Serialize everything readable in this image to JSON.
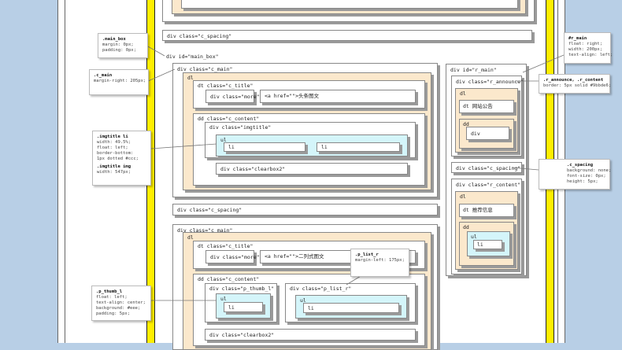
{
  "colors": {
    "background": "#b8cfe6",
    "page": "#ffffff",
    "stripe": "#ffee00",
    "cream": "#fbe8cc",
    "cyan": "#d4f5fa"
  },
  "top": {
    "spacing": "div class=\"c_spacing\"",
    "main_box": "div id=\"main_box\""
  },
  "c_main_1": {
    "label": "div class=\"c_main\"",
    "dl": "dl",
    "dt": "dt class=\"c_title\"",
    "more": "div class=\"more\"",
    "link": "<a href=\"\">头条图文",
    "dd": "dd class=\"c_content\"",
    "imgtitle": "div class=\"imgtitle\"",
    "ul": "ul",
    "li1": "li",
    "li2": "li",
    "clearbox": "div class=\"clearbox2\""
  },
  "middle_spacing": "div class=\"c_spacing\"",
  "c_main_2": {
    "label": "div class=\"c_main\"",
    "dl": "dl",
    "dt": "dt class=\"c_title\"",
    "more": "div class=\"more\"",
    "link": "<a href=\"\">二列式图文",
    "dd": "dd class=\"c_content\"",
    "thumb": "div class=\"p_thumb_l\"",
    "list": "div class=\"p_list_r\"",
    "ul1": "ul",
    "li1": "li",
    "ul2": "ul",
    "li2": "li",
    "clearbox": "div class=\"clearbox2\""
  },
  "right": {
    "r_main": "div id=\"r_main\"",
    "announce": "div class=\"r_announce\"",
    "dl1": "dl",
    "dt1": "dt  网站公告",
    "dd1": "dd",
    "div": "div",
    "spacing": "div class=\"c_spacing\"",
    "content": "div class=\"r_content\"",
    "dl2": "dl",
    "dt2": "dt  推荐信息",
    "dd2": "dd",
    "ul": "ul",
    "li": "li"
  },
  "notes": {
    "main_box": {
      "sel": ".main_box",
      "lines": [
        "margin: 0px;",
        "padding: 0px;"
      ]
    },
    "c_main": {
      "sel": ".c_main",
      "lines": [
        "margin-right: 205px;"
      ]
    },
    "imgtitle": {
      "sel": ".imgtitle li",
      "lines": [
        "width: 49.5%;",
        "float: left;",
        "border-bottom:",
        "  1px dotted #ccc;"
      ],
      "sel2": ".imgtitle img",
      "lines2": [
        "width: 547px;"
      ]
    },
    "p_thumb": {
      "sel": ".p_thumb_l",
      "lines": [
        "float: left;",
        "text-align: center;",
        "background: #eee;",
        "padding: 5px;"
      ]
    },
    "p_list": {
      "sel": ".p_list_r",
      "lines": [
        "margin-left: 175px;"
      ]
    },
    "r_main": {
      "sel": "#r_main",
      "lines": [
        "float: right;",
        "width: 200px;",
        "text-align: left;"
      ]
    },
    "r_announce": {
      "sel": ".r_announce, .r_content",
      "lines": [
        "border: 5px solid #9bbde6;"
      ]
    },
    "c_spacing": {
      "sel": ".c_spacing",
      "lines": [
        "background: none;",
        "font-size: 0px;",
        "height: 5px;"
      ]
    }
  }
}
